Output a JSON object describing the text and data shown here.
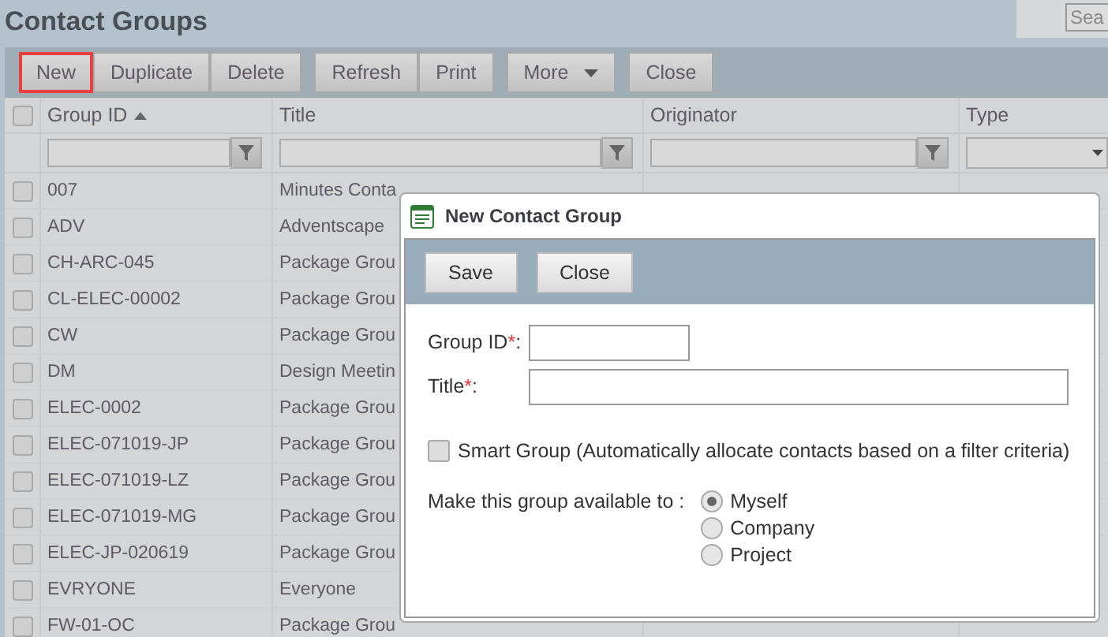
{
  "page": {
    "title": "Contact Groups",
    "search": {
      "placeholder": "Sea"
    }
  },
  "toolbar": {
    "groups": [
      [
        {
          "label": "New",
          "kind": "button",
          "focused": true
        },
        {
          "label": "Duplicate",
          "kind": "button",
          "focused": false
        },
        {
          "label": "Delete",
          "kind": "button",
          "focused": false
        }
      ],
      [
        {
          "label": "Refresh",
          "kind": "button",
          "focused": false
        },
        {
          "label": "Print",
          "kind": "button",
          "focused": false
        }
      ],
      [
        {
          "label": "More",
          "kind": "menu",
          "focused": false
        }
      ],
      [
        {
          "label": "Close",
          "kind": "button",
          "focused": false
        }
      ]
    ]
  },
  "grid": {
    "select_all": {
      "checked": false
    },
    "columns": [
      {
        "label": "Group ID",
        "sorted": true,
        "kind": "text"
      },
      {
        "label": "Title",
        "sorted": false,
        "kind": "text"
      },
      {
        "label": "Originator",
        "sorted": false,
        "kind": "text"
      },
      {
        "label": "Type",
        "sorted": false,
        "kind": "dropdown"
      }
    ],
    "rows": [
      {
        "checked": false,
        "group_id": "007",
        "title": "Minutes Conta"
      },
      {
        "checked": false,
        "group_id": "ADV",
        "title": "Adventscape"
      },
      {
        "checked": false,
        "group_id": "CH-ARC-045",
        "title": "Package Grou"
      },
      {
        "checked": false,
        "group_id": "CL-ELEC-00002",
        "title": "Package Grou"
      },
      {
        "checked": false,
        "group_id": "CW",
        "title": "Package Grou"
      },
      {
        "checked": false,
        "group_id": "DM",
        "title": "Design Meetin"
      },
      {
        "checked": false,
        "group_id": "ELEC-0002",
        "title": "Package Grou"
      },
      {
        "checked": false,
        "group_id": "ELEC-071019-JP",
        "title": "Package Grou"
      },
      {
        "checked": false,
        "group_id": "ELEC-071019-LZ",
        "title": "Package Grou"
      },
      {
        "checked": false,
        "group_id": "ELEC-071019-MG",
        "title": "Package Grou"
      },
      {
        "checked": false,
        "group_id": "ELEC-JP-020619",
        "title": "Package Grou"
      },
      {
        "checked": false,
        "group_id": "EVRYONE",
        "title": "Everyone"
      },
      {
        "checked": false,
        "group_id": "FW-01-OC",
        "title": "Package Grou"
      }
    ]
  },
  "dialog": {
    "title": "New Contact Group",
    "buttons": [
      "Save",
      "Close"
    ],
    "fields": [
      {
        "label": "Group ID",
        "mark": "*",
        "suffix": ":",
        "kind": "short"
      },
      {
        "label": "Title",
        "mark": "*",
        "suffix": ":",
        "kind": "long"
      }
    ],
    "smart_group": {
      "label": "Smart Group (Automatically allocate contacts based on a filter criteria)",
      "checked": false
    },
    "availability": {
      "label": "Make this group available to :",
      "options": [
        {
          "label": "Myself",
          "selected": true
        },
        {
          "label": "Company",
          "selected": false
        },
        {
          "label": "Project",
          "selected": false
        }
      ]
    }
  }
}
